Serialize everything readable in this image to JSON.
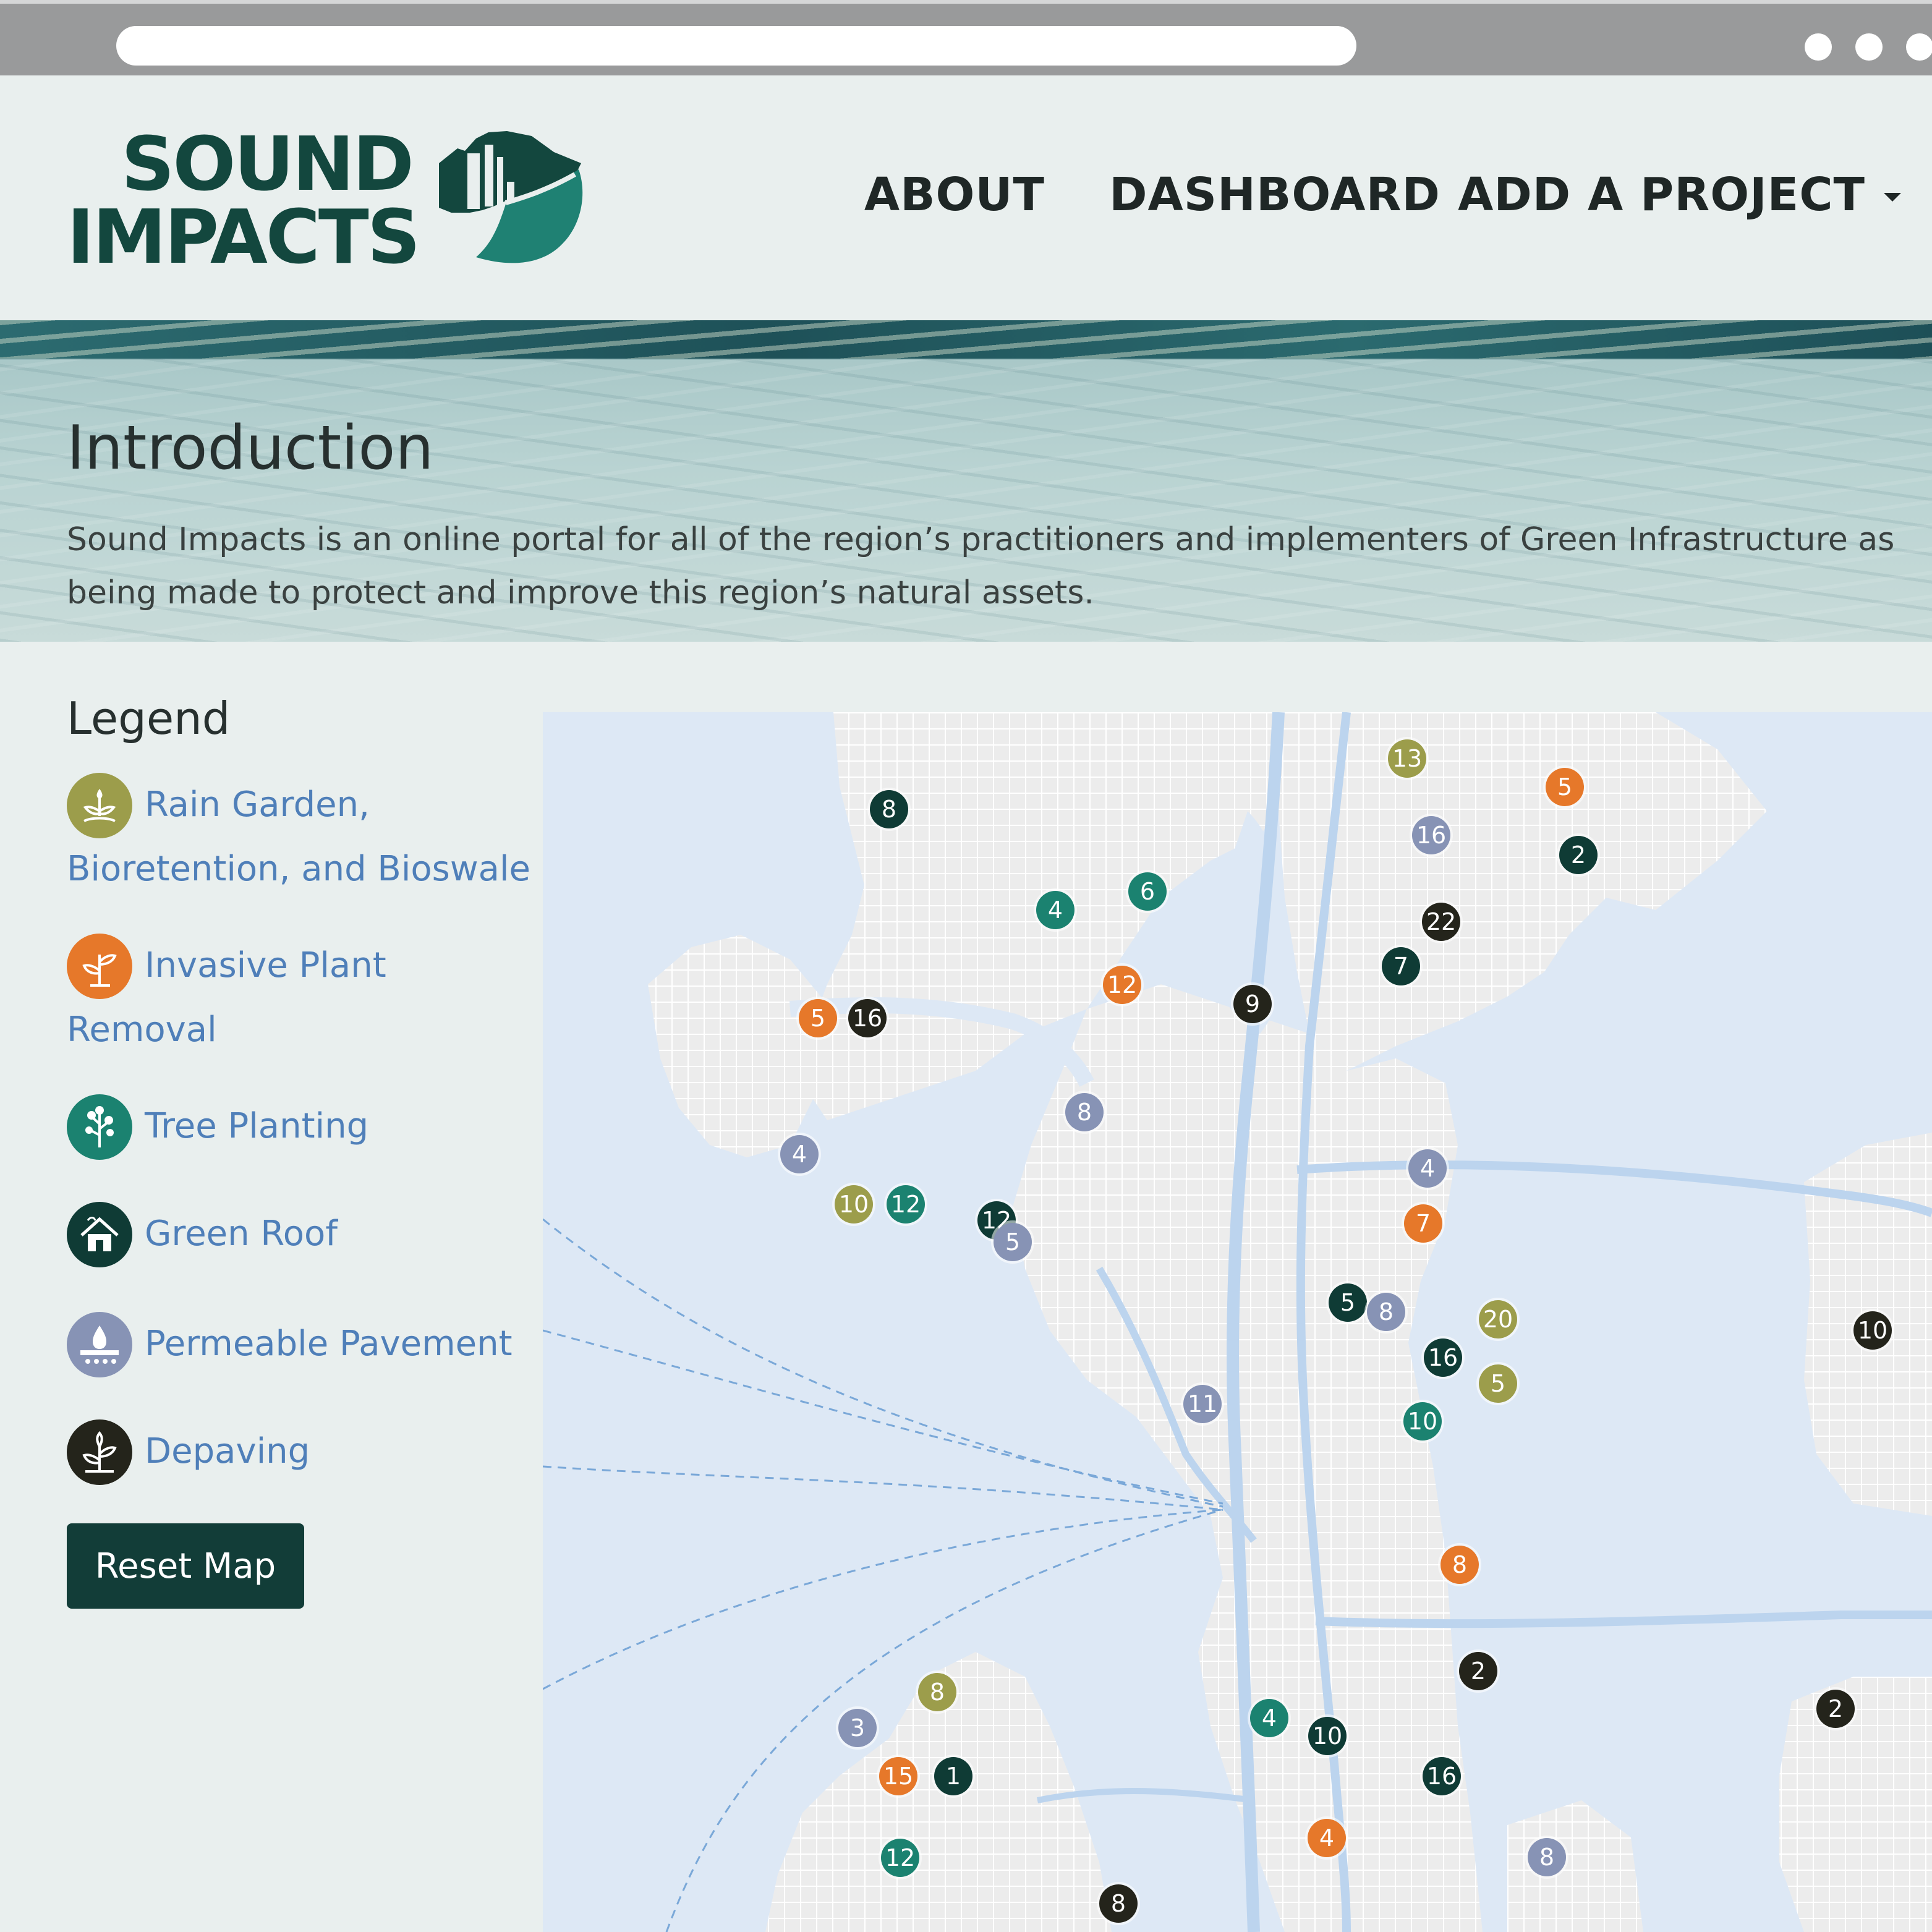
{
  "browser": {
    "controls": [
      "dot",
      "dot",
      "dot"
    ]
  },
  "header": {
    "logo_line1": "SOUND",
    "logo_line2": "IMPACTS",
    "nav": [
      {
        "label": "ABOUT"
      },
      {
        "label": "DASHBOARD"
      },
      {
        "label": "ADD A PROJECT"
      }
    ]
  },
  "intro": {
    "title": "Introduction",
    "text_line1": "Sound Impacts is an online portal for all of the region’s practitioners and implementers of Green Infrastructure as",
    "text_line2": "being made to protect and improve this region’s natural assets."
  },
  "legend": {
    "title": "Legend",
    "items": [
      {
        "label_line1": "Rain Garden,",
        "label_line2": "Bioretention, and Bioswale",
        "icon": "rain-garden-icon",
        "color": "#9c9d4b"
      },
      {
        "label_line1": "Invasive Plant",
        "label_line2": "Removal",
        "icon": "invasive-plant-icon",
        "color": "#e6782a"
      },
      {
        "label_line1": "Tree Planting",
        "icon": "tree-icon",
        "color": "#1b8270"
      },
      {
        "label_line1": "Green Roof",
        "icon": "house-icon",
        "color": "#0f3b35"
      },
      {
        "label_line1": "Permeable Pavement",
        "icon": "droplet-icon",
        "color": "#8793b5"
      },
      {
        "label_line1": "Depaving",
        "icon": "sprout-icon",
        "color": "#24241b"
      }
    ],
    "reset_label": "Reset Map"
  },
  "map": {
    "markers": [
      {
        "label": "13",
        "type": "rain"
      },
      {
        "label": "5",
        "type": "inv"
      },
      {
        "label": "8",
        "type": "roof"
      },
      {
        "label": "16",
        "type": "perm"
      },
      {
        "label": "2",
        "type": "roof"
      },
      {
        "label": "6",
        "type": "tree"
      },
      {
        "label": "4",
        "type": "tree"
      },
      {
        "label": "22",
        "type": "dep"
      },
      {
        "label": "7",
        "type": "roof"
      },
      {
        "label": "12",
        "type": "inv"
      },
      {
        "label": "9",
        "type": "dep"
      },
      {
        "label": "5",
        "type": "inv"
      },
      {
        "label": "16",
        "type": "dep"
      },
      {
        "label": "8",
        "type": "perm"
      },
      {
        "label": "4",
        "type": "perm"
      },
      {
        "label": "4",
        "type": "perm"
      },
      {
        "label": "10",
        "type": "rain"
      },
      {
        "label": "12",
        "type": "tree"
      },
      {
        "label": "12",
        "type": "roof"
      },
      {
        "label": "5",
        "type": "perm"
      },
      {
        "label": "7",
        "type": "inv"
      },
      {
        "label": "5",
        "type": "roof"
      },
      {
        "label": "8",
        "type": "perm"
      },
      {
        "label": "20",
        "type": "rain"
      },
      {
        "label": "10",
        "type": "dep"
      },
      {
        "label": "16",
        "type": "roof"
      },
      {
        "label": "5",
        "type": "rain"
      },
      {
        "label": "11",
        "type": "perm"
      },
      {
        "label": "10",
        "type": "tree"
      },
      {
        "label": "8",
        "type": "inv"
      },
      {
        "label": "2",
        "type": "dep"
      },
      {
        "label": "8",
        "type": "rain"
      },
      {
        "label": "2",
        "type": "dep"
      },
      {
        "label": "3",
        "type": "perm"
      },
      {
        "label": "4",
        "type": "tree"
      },
      {
        "label": "10",
        "type": "roof"
      },
      {
        "label": "15",
        "type": "inv"
      },
      {
        "label": "1",
        "type": "roof"
      },
      {
        "label": "16",
        "type": "roof"
      },
      {
        "label": "4",
        "type": "inv"
      },
      {
        "label": "12",
        "type": "tree"
      },
      {
        "label": "8",
        "type": "perm"
      },
      {
        "label": "8",
        "type": "dep"
      }
    ]
  }
}
